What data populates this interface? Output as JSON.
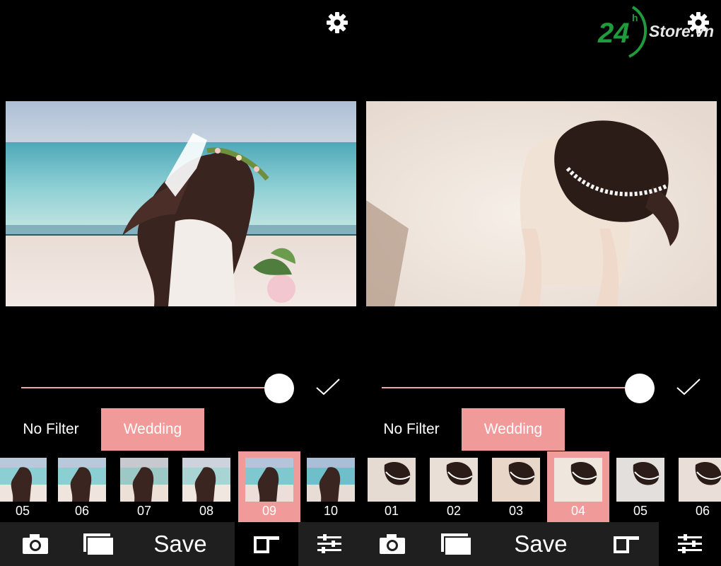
{
  "brand": {
    "logo_number": "24",
    "logo_sup": "h",
    "logo_text": "Store.vn",
    "logo_color": "#1e9b3a"
  },
  "accent_color": "#f19a9a",
  "left": {
    "categories": [
      "No Filter",
      "Wedding"
    ],
    "active_category": "Wedding",
    "slider_value": 0.9,
    "thumbs": [
      "05",
      "06",
      "07",
      "08",
      "09",
      "10"
    ],
    "active_thumb": "09",
    "toolbar": {
      "save_label": "Save"
    }
  },
  "right": {
    "categories": [
      "No Filter",
      "Wedding"
    ],
    "active_category": "Wedding",
    "slider_value": 0.9,
    "thumbs": [
      "01",
      "02",
      "03",
      "04",
      "05",
      "06"
    ],
    "active_thumb": "04",
    "toolbar": {
      "save_label": "Save"
    }
  }
}
